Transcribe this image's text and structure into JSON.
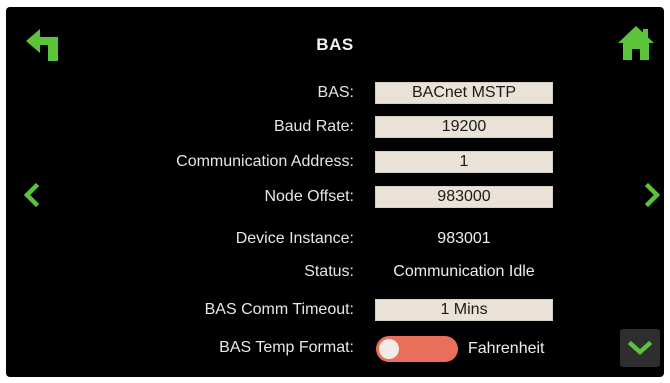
{
  "header": {
    "title": "BAS"
  },
  "colors": {
    "accent": "#5bc43a",
    "field_bg": "#eae2d6",
    "toggle": "#e8705a",
    "screen_bg": "#000000"
  },
  "icons": {
    "back": "back-arrow-icon",
    "home": "home-icon",
    "prev": "chevron-left-icon",
    "next": "chevron-right-icon",
    "scroll": "chevron-down-icon"
  },
  "settings": {
    "bas": {
      "label": "BAS:",
      "value": "BACnet MSTP"
    },
    "baud_rate": {
      "label": "Baud Rate:",
      "value": "19200"
    },
    "comm_address": {
      "label": "Communication Address:",
      "value": "1"
    },
    "node_offset": {
      "label": "Node Offset:",
      "value": "983000"
    },
    "device_instance": {
      "label": "Device Instance:",
      "value": "983001"
    },
    "status": {
      "label": "Status:",
      "value": "Communication Idle"
    },
    "comm_timeout": {
      "label": "BAS Comm Timeout:",
      "value": "1 Mins"
    },
    "temp_format": {
      "label": "BAS Temp Format:",
      "value": "Fahrenheit",
      "toggle_on": false
    }
  }
}
